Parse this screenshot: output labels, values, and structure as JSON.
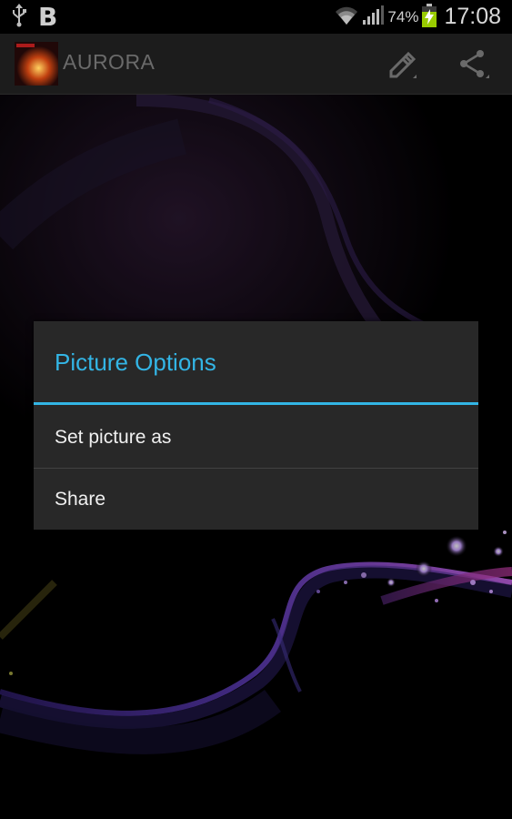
{
  "status_bar": {
    "left_icons": [
      "usb-icon",
      "b-app-icon"
    ],
    "b_letter": "B",
    "battery_percent": "74%",
    "time": "17:08"
  },
  "action_bar": {
    "title": "AURORA",
    "actions": [
      "pencil-icon",
      "share-icon"
    ]
  },
  "dialog": {
    "title": "Picture Options",
    "items": [
      {
        "label": "Set picture as"
      },
      {
        "label": "Share"
      }
    ],
    "accent_color": "#33b5e5"
  }
}
